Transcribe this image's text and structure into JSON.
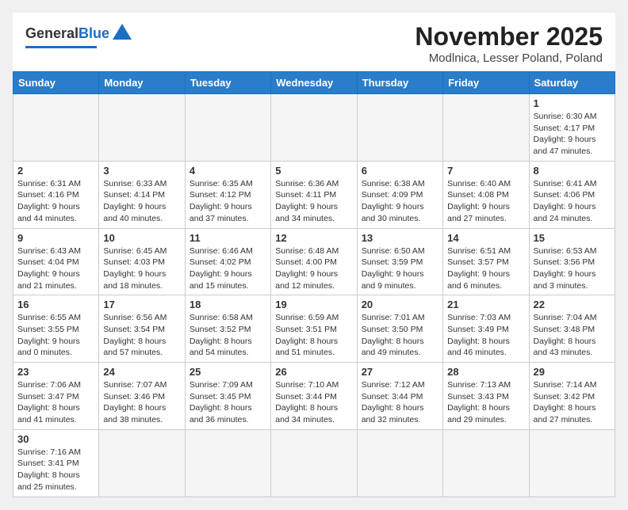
{
  "header": {
    "logo_general": "General",
    "logo_blue": "Blue",
    "month_year": "November 2025",
    "location": "Modlnica, Lesser Poland, Poland"
  },
  "days_of_week": [
    "Sunday",
    "Monday",
    "Tuesday",
    "Wednesday",
    "Thursday",
    "Friday",
    "Saturday"
  ],
  "weeks": [
    [
      {
        "day": "",
        "info": ""
      },
      {
        "day": "",
        "info": ""
      },
      {
        "day": "",
        "info": ""
      },
      {
        "day": "",
        "info": ""
      },
      {
        "day": "",
        "info": ""
      },
      {
        "day": "",
        "info": ""
      },
      {
        "day": "1",
        "info": "Sunrise: 6:30 AM\nSunset: 4:17 PM\nDaylight: 9 hours and 47 minutes."
      }
    ],
    [
      {
        "day": "2",
        "info": "Sunrise: 6:31 AM\nSunset: 4:16 PM\nDaylight: 9 hours and 44 minutes."
      },
      {
        "day": "3",
        "info": "Sunrise: 6:33 AM\nSunset: 4:14 PM\nDaylight: 9 hours and 40 minutes."
      },
      {
        "day": "4",
        "info": "Sunrise: 6:35 AM\nSunset: 4:12 PM\nDaylight: 9 hours and 37 minutes."
      },
      {
        "day": "5",
        "info": "Sunrise: 6:36 AM\nSunset: 4:11 PM\nDaylight: 9 hours and 34 minutes."
      },
      {
        "day": "6",
        "info": "Sunrise: 6:38 AM\nSunset: 4:09 PM\nDaylight: 9 hours and 30 minutes."
      },
      {
        "day": "7",
        "info": "Sunrise: 6:40 AM\nSunset: 4:08 PM\nDaylight: 9 hours and 27 minutes."
      },
      {
        "day": "8",
        "info": "Sunrise: 6:41 AM\nSunset: 4:06 PM\nDaylight: 9 hours and 24 minutes."
      }
    ],
    [
      {
        "day": "9",
        "info": "Sunrise: 6:43 AM\nSunset: 4:04 PM\nDaylight: 9 hours and 21 minutes."
      },
      {
        "day": "10",
        "info": "Sunrise: 6:45 AM\nSunset: 4:03 PM\nDaylight: 9 hours and 18 minutes."
      },
      {
        "day": "11",
        "info": "Sunrise: 6:46 AM\nSunset: 4:02 PM\nDaylight: 9 hours and 15 minutes."
      },
      {
        "day": "12",
        "info": "Sunrise: 6:48 AM\nSunset: 4:00 PM\nDaylight: 9 hours and 12 minutes."
      },
      {
        "day": "13",
        "info": "Sunrise: 6:50 AM\nSunset: 3:59 PM\nDaylight: 9 hours and 9 minutes."
      },
      {
        "day": "14",
        "info": "Sunrise: 6:51 AM\nSunset: 3:57 PM\nDaylight: 9 hours and 6 minutes."
      },
      {
        "day": "15",
        "info": "Sunrise: 6:53 AM\nSunset: 3:56 PM\nDaylight: 9 hours and 3 minutes."
      }
    ],
    [
      {
        "day": "16",
        "info": "Sunrise: 6:55 AM\nSunset: 3:55 PM\nDaylight: 9 hours and 0 minutes."
      },
      {
        "day": "17",
        "info": "Sunrise: 6:56 AM\nSunset: 3:54 PM\nDaylight: 8 hours and 57 minutes."
      },
      {
        "day": "18",
        "info": "Sunrise: 6:58 AM\nSunset: 3:52 PM\nDaylight: 8 hours and 54 minutes."
      },
      {
        "day": "19",
        "info": "Sunrise: 6:59 AM\nSunset: 3:51 PM\nDaylight: 8 hours and 51 minutes."
      },
      {
        "day": "20",
        "info": "Sunrise: 7:01 AM\nSunset: 3:50 PM\nDaylight: 8 hours and 49 minutes."
      },
      {
        "day": "21",
        "info": "Sunrise: 7:03 AM\nSunset: 3:49 PM\nDaylight: 8 hours and 46 minutes."
      },
      {
        "day": "22",
        "info": "Sunrise: 7:04 AM\nSunset: 3:48 PM\nDaylight: 8 hours and 43 minutes."
      }
    ],
    [
      {
        "day": "23",
        "info": "Sunrise: 7:06 AM\nSunset: 3:47 PM\nDaylight: 8 hours and 41 minutes."
      },
      {
        "day": "24",
        "info": "Sunrise: 7:07 AM\nSunset: 3:46 PM\nDaylight: 8 hours and 38 minutes."
      },
      {
        "day": "25",
        "info": "Sunrise: 7:09 AM\nSunset: 3:45 PM\nDaylight: 8 hours and 36 minutes."
      },
      {
        "day": "26",
        "info": "Sunrise: 7:10 AM\nSunset: 3:44 PM\nDaylight: 8 hours and 34 minutes."
      },
      {
        "day": "27",
        "info": "Sunrise: 7:12 AM\nSunset: 3:44 PM\nDaylight: 8 hours and 32 minutes."
      },
      {
        "day": "28",
        "info": "Sunrise: 7:13 AM\nSunset: 3:43 PM\nDaylight: 8 hours and 29 minutes."
      },
      {
        "day": "29",
        "info": "Sunrise: 7:14 AM\nSunset: 3:42 PM\nDaylight: 8 hours and 27 minutes."
      }
    ],
    [
      {
        "day": "30",
        "info": "Sunrise: 7:16 AM\nSunset: 3:41 PM\nDaylight: 8 hours and 25 minutes."
      },
      {
        "day": "",
        "info": ""
      },
      {
        "day": "",
        "info": ""
      },
      {
        "day": "",
        "info": ""
      },
      {
        "day": "",
        "info": ""
      },
      {
        "day": "",
        "info": ""
      },
      {
        "day": "",
        "info": ""
      }
    ]
  ]
}
